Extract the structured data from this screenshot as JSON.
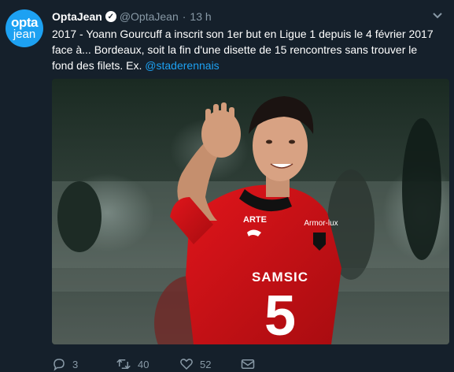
{
  "account": {
    "avatar_line1": "opta",
    "avatar_line2": "jean",
    "name": "OptaJean",
    "handle": "@OptaJean",
    "separator": "·",
    "time": "13 h"
  },
  "tweet": {
    "text_before": "2017 - Yoann Gourcuff a inscrit son 1er but en Ligue 1 depuis le 4 février 2017 face à... Bordeaux, soit la fin d'une disette de 15 rencontres sans trouver le fond des filets. Ex. ",
    "mention": "@staderennais"
  },
  "media": {
    "jersey_sponsor": "SAMSIC",
    "jersey_number": "5",
    "jersey_maker": "ARTE",
    "chest_text": "Armor-lux"
  },
  "actions": {
    "replies": "3",
    "retweets": "40",
    "likes": "52"
  },
  "colors": {
    "background": "#15202b",
    "accent": "#1da1f2",
    "muted": "#8899a6"
  }
}
